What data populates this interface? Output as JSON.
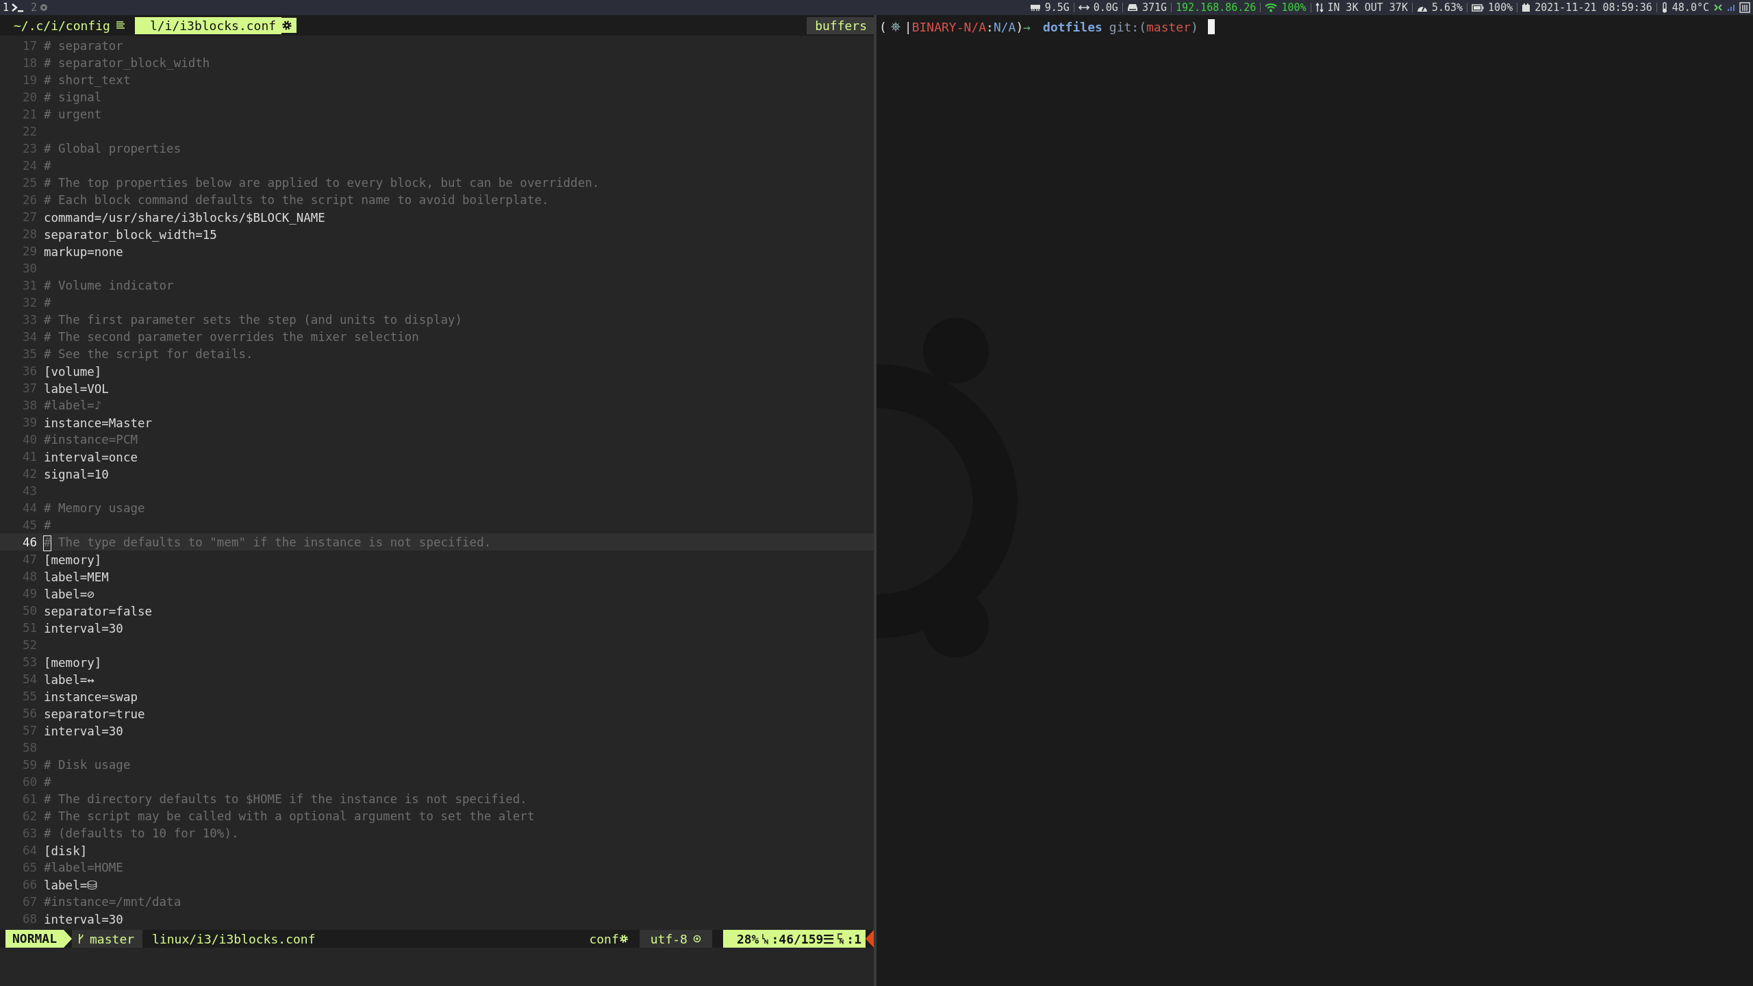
{
  "topbar": {
    "workspaces": [
      {
        "number": "1",
        "kind": "terminal",
        "selected": true
      },
      {
        "number": "2",
        "kind": "browser",
        "selected": false
      }
    ],
    "blocks": [
      {
        "kind": "memory",
        "text": "9.5G",
        "color": "#d8d8d8"
      },
      {
        "kind": "swap",
        "text": "0.0G",
        "color": "#d8d8d8"
      },
      {
        "kind": "disk",
        "text": "371G",
        "color": "#d8d8d8"
      },
      {
        "kind": "ip",
        "text": "192.168.86.26",
        "color": "#3fd13f"
      },
      {
        "kind": "wifi",
        "text": "100%",
        "color": "#3fd13f"
      },
      {
        "kind": "traffic",
        "text": "IN 3K OUT 37K",
        "color": "#d8d8d8"
      },
      {
        "kind": "cpu",
        "text": "5.63%",
        "color": "#d8d8d8"
      },
      {
        "kind": "battery",
        "text": "100%",
        "color": "#d8d8d8"
      },
      {
        "kind": "date",
        "text": "2021-11-21 08:59:36",
        "color": "#d8d8d8"
      },
      {
        "kind": "temperature",
        "text": "48.0°C",
        "color": "#d8d8d8"
      }
    ]
  },
  "editor": {
    "tabs": [
      {
        "label": "~/.c/i/config",
        "selected": false
      },
      {
        "label": "l/i/i3blocks.conf",
        "selected": true
      }
    ],
    "buffers_label": "buffers",
    "lines": [
      {
        "n": "17",
        "text": "# separator",
        "kind": "comment",
        "current": false
      },
      {
        "n": "18",
        "text": "# separator_block_width",
        "kind": "comment",
        "current": false
      },
      {
        "n": "19",
        "text": "# short_text",
        "kind": "comment",
        "current": false
      },
      {
        "n": "20",
        "text": "# signal",
        "kind": "comment",
        "current": false
      },
      {
        "n": "21",
        "text": "# urgent",
        "kind": "comment",
        "current": false
      },
      {
        "n": "22",
        "kind": "blank",
        "current": false
      },
      {
        "n": "23",
        "text": "# Global properties",
        "kind": "comment",
        "current": false
      },
      {
        "n": "24",
        "text": "#",
        "kind": "comment",
        "current": false
      },
      {
        "n": "25",
        "text": "# The top properties below are applied to every block, but can be overridden.",
        "kind": "comment",
        "current": false
      },
      {
        "n": "26",
        "text": "# Each block command defaults to the script name to avoid boilerplate.",
        "kind": "comment",
        "current": false
      },
      {
        "n": "27",
        "text": "command=/usr/share/i3blocks/$BLOCK_NAME",
        "kind": "code",
        "current": false
      },
      {
        "n": "28",
        "text": "separator_block_width=15",
        "kind": "code",
        "current": false
      },
      {
        "n": "29",
        "text": "markup=none",
        "kind": "code",
        "current": false
      },
      {
        "n": "30",
        "kind": "blank",
        "current": false
      },
      {
        "n": "31",
        "text": "# Volume indicator",
        "kind": "comment",
        "current": false
      },
      {
        "n": "32",
        "text": "#",
        "kind": "comment",
        "current": false
      },
      {
        "n": "33",
        "text": "# The first parameter sets the step (and units to display)",
        "kind": "comment",
        "current": false
      },
      {
        "n": "34",
        "text": "# The second parameter overrides the mixer selection",
        "kind": "comment",
        "current": false
      },
      {
        "n": "35",
        "text": "# See the script for details.",
        "kind": "comment",
        "current": false
      },
      {
        "n": "36",
        "text": "[volume]",
        "kind": "code",
        "current": false
      },
      {
        "n": "37",
        "text": "label=VOL",
        "kind": "code",
        "current": false
      },
      {
        "n": "38",
        "text": "#label=♪",
        "kind": "comment",
        "current": false
      },
      {
        "n": "39",
        "text": "instance=Master",
        "kind": "code",
        "current": false
      },
      {
        "n": "40",
        "text": "#instance=PCM",
        "kind": "comment",
        "current": false
      },
      {
        "n": "41",
        "text": "interval=once",
        "kind": "code",
        "current": false
      },
      {
        "n": "42",
        "text": "signal=10",
        "kind": "code",
        "current": false
      },
      {
        "n": "43",
        "kind": "blank",
        "current": false
      },
      {
        "n": "44",
        "text": "# Memory usage",
        "kind": "comment",
        "current": false
      },
      {
        "n": "45",
        "text": "#",
        "kind": "comment",
        "current": false
      },
      {
        "n": "46",
        "text": "# The type defaults to \"mem\" if the instance is not specified.",
        "kind": "comment",
        "current": true
      },
      {
        "n": "47",
        "text": "[memory]",
        "kind": "code",
        "current": false
      },
      {
        "n": "48",
        "text": "label=MEM",
        "kind": "code",
        "current": false
      },
      {
        "n": "49",
        "text": "label=⊘",
        "kind": "code",
        "current": false
      },
      {
        "n": "50",
        "text": "separator=false",
        "kind": "code",
        "current": false
      },
      {
        "n": "51",
        "text": "interval=30",
        "kind": "code",
        "current": false
      },
      {
        "n": "52",
        "kind": "blank",
        "current": false
      },
      {
        "n": "53",
        "text": "[memory]",
        "kind": "code",
        "current": false
      },
      {
        "n": "54",
        "text": "label=↔",
        "kind": "code",
        "current": false
      },
      {
        "n": "55",
        "text": "instance=swap",
        "kind": "code",
        "current": false
      },
      {
        "n": "56",
        "text": "separator=true",
        "kind": "code",
        "current": false
      },
      {
        "n": "57",
        "text": "interval=30",
        "kind": "code",
        "current": false
      },
      {
        "n": "58",
        "kind": "blank",
        "current": false
      },
      {
        "n": "59",
        "text": "# Disk usage",
        "kind": "comment",
        "current": false
      },
      {
        "n": "60",
        "text": "#",
        "kind": "comment",
        "current": false
      },
      {
        "n": "61",
        "text": "# The directory defaults to $HOME if the instance is not specified.",
        "kind": "comment",
        "current": false
      },
      {
        "n": "62",
        "text": "# The script may be called with a optional argument to set the alert",
        "kind": "comment",
        "current": false
      },
      {
        "n": "63",
        "text": "# (defaults to 10 for 10%).",
        "kind": "comment",
        "current": false
      },
      {
        "n": "64",
        "text": "[disk]",
        "kind": "code",
        "current": false
      },
      {
        "n": "65",
        "text": "#label=HOME",
        "kind": "comment",
        "current": false
      },
      {
        "n": "66",
        "text": "label=⛁",
        "kind": "code",
        "current": false
      },
      {
        "n": "67",
        "text": "#instance=/mnt/data",
        "kind": "comment",
        "current": false
      },
      {
        "n": "68",
        "text": "interval=30",
        "kind": "code",
        "current": false
      }
    ],
    "statusline": {
      "mode": "NORMAL",
      "branch": "master",
      "file": "linux/i3/i3blocks.conf",
      "filetype": "conf",
      "encoding": "utf-8",
      "percent": "28%",
      "line": ":46/159☰",
      "column": ":1"
    }
  },
  "terminal": {
    "prompt": [
      {
        "text": "(",
        "color": "#e0e0e0"
      },
      {
        "text": "|",
        "color": "#e0e0e0"
      },
      {
        "text": "BINARY-N/A",
        "color": "#d9534f"
      },
      {
        "text": ":",
        "color": "#e0e0e0"
      },
      {
        "text": "N/A",
        "color": "#7ea6dc"
      },
      {
        "text": ")",
        "color": "#e0e0e0"
      },
      {
        "text": "→",
        "color": "#5fa77f"
      }
    ],
    "directory": "dotfiles",
    "git_label": "git:(",
    "git_branch": "master",
    "git_close": ")"
  }
}
